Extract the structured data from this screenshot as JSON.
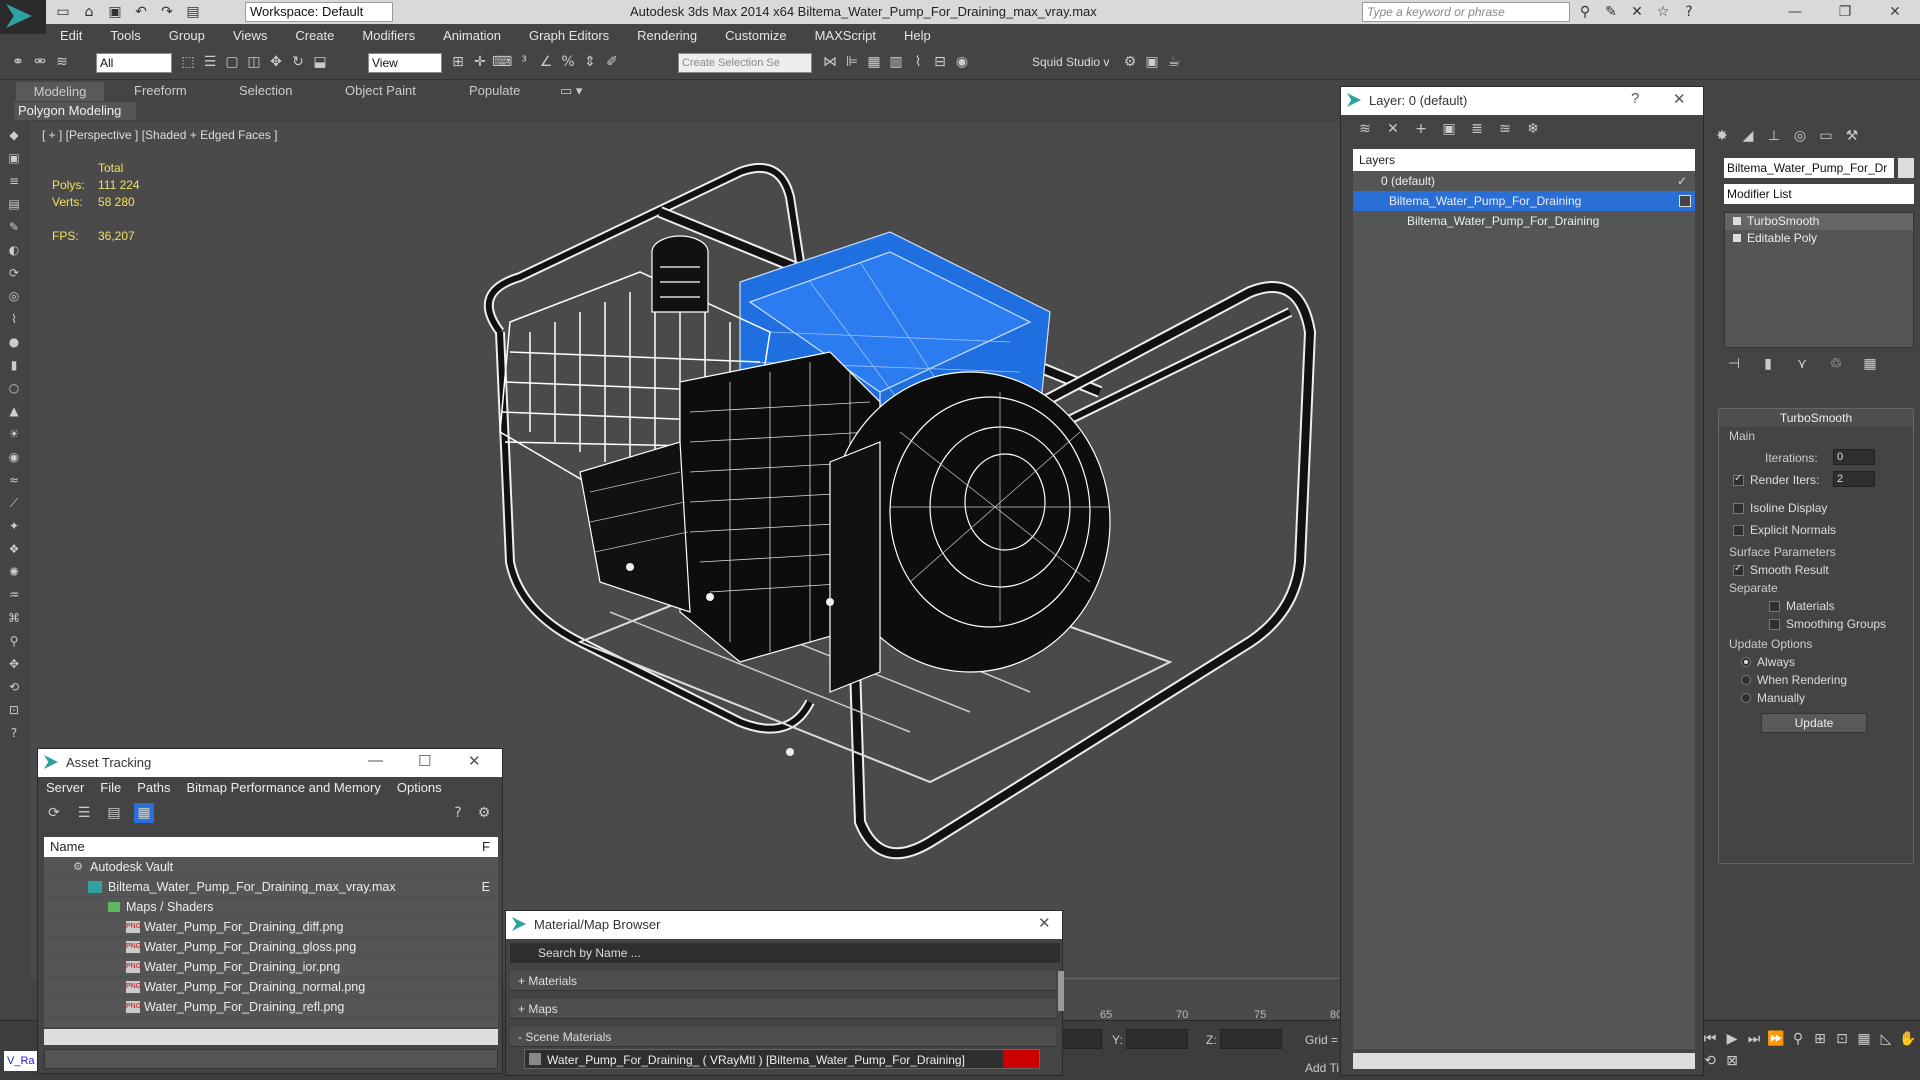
{
  "app": {
    "title": "Autodesk 3ds Max  2014 x64    Biltema_Water_Pump_For_Draining_max_vray.max",
    "workspace": "Workspace: Default",
    "search_placeholder": "Type a keyword or phrase"
  },
  "menu": [
    "Edit",
    "Tools",
    "Group",
    "Views",
    "Create",
    "Modifiers",
    "Animation",
    "Graph Editors",
    "Rendering",
    "Customize",
    "MAXScript",
    "Help"
  ],
  "toolbar": {
    "filter": "All",
    "view": "View",
    "selection_set_placeholder": "Create Selection Se",
    "squid": "Squid Studio v"
  },
  "ribbon": {
    "tabs": [
      "Modeling",
      "Freeform",
      "Selection",
      "Object Paint",
      "Populate"
    ],
    "sub": "Polygon Modeling"
  },
  "viewport": {
    "label": "[ + ] [Perspective ] [Shaded + Edged Faces ]",
    "stats": {
      "header": "Total",
      "polys_label": "Polys:",
      "polys": "111 224",
      "verts_label": "Verts:",
      "verts": "58 280",
      "fps_label": "FPS:",
      "fps": "36,207"
    }
  },
  "layer_panel": {
    "title": "Layer: 0 (default)",
    "help": "?",
    "header": "Layers",
    "rows": [
      "0 (default)",
      "Biltema_Water_Pump_For_Draining",
      "Biltema_Water_Pump_For_Draining"
    ]
  },
  "command_panel": {
    "object_name": "Biltema_Water_Pump_For_Dr",
    "modifier_list": "Modifier List",
    "stack": [
      "TurboSmooth",
      "Editable Poly"
    ],
    "rollout": "TurboSmooth",
    "main": "Main",
    "iterations_label": "Iterations:",
    "iterations": "0",
    "render_iters_label": "Render Iters:",
    "render_iters": "2",
    "isoline": "Isoline Display",
    "explicit_normals": "Explicit Normals",
    "surface_params": "Surface Parameters",
    "smooth_result": "Smooth Result",
    "separate": "Separate",
    "materials": "Materials",
    "smoothing_groups": "Smoothing Groups",
    "update_options": "Update Options",
    "always": "Always",
    "when_rendering": "When Rendering",
    "manually": "Manually",
    "update_button": "Update"
  },
  "asset_tracking": {
    "title": "Asset Tracking",
    "menu": [
      "Server",
      "File",
      "Paths",
      "Bitmap Performance and Memory",
      "Options"
    ],
    "col_name": "Name",
    "col_f": "F",
    "rows": [
      {
        "name": "Autodesk Vault",
        "flag": ""
      },
      {
        "name": "Biltema_Water_Pump_For_Draining_max_vray.max",
        "flag": "E"
      },
      {
        "name": "Maps / Shaders",
        "flag": ""
      },
      {
        "name": "Water_Pump_For_Draining_diff.png",
        "flag": ""
      },
      {
        "name": "Water_Pump_For_Draining_gloss.png",
        "flag": ""
      },
      {
        "name": "Water_Pump_For_Draining_ior.png",
        "flag": ""
      },
      {
        "name": "Water_Pump_For_Draining_normal.png",
        "flag": ""
      },
      {
        "name": "Water_Pump_For_Draining_refl.png",
        "flag": ""
      }
    ],
    "file_badge": "PNG"
  },
  "material_browser": {
    "title": "Material/Map Browser",
    "search_placeholder": "Search by Name ...",
    "sections": [
      "+ Materials",
      "+ Maps",
      "- Scene Materials"
    ],
    "item": "Water_Pump_For_Draining_ ( VRayMtl ) [Biltema_Water_Pump_For_Draining]"
  },
  "timeline": {
    "ticks": [
      "65",
      "70",
      "75",
      "80"
    ]
  },
  "coords": {
    "y_label": "Y:",
    "z_label": "Z:",
    "grid_label": "Grid =",
    "add_time": "Add Ti",
    "maxscript": "V_Ra"
  },
  "colors": {
    "accent": "#2a6fd6",
    "stats_text": "#f0e060",
    "tank_blue": "#1f6fe0",
    "swatch_red": "#cc0000"
  }
}
